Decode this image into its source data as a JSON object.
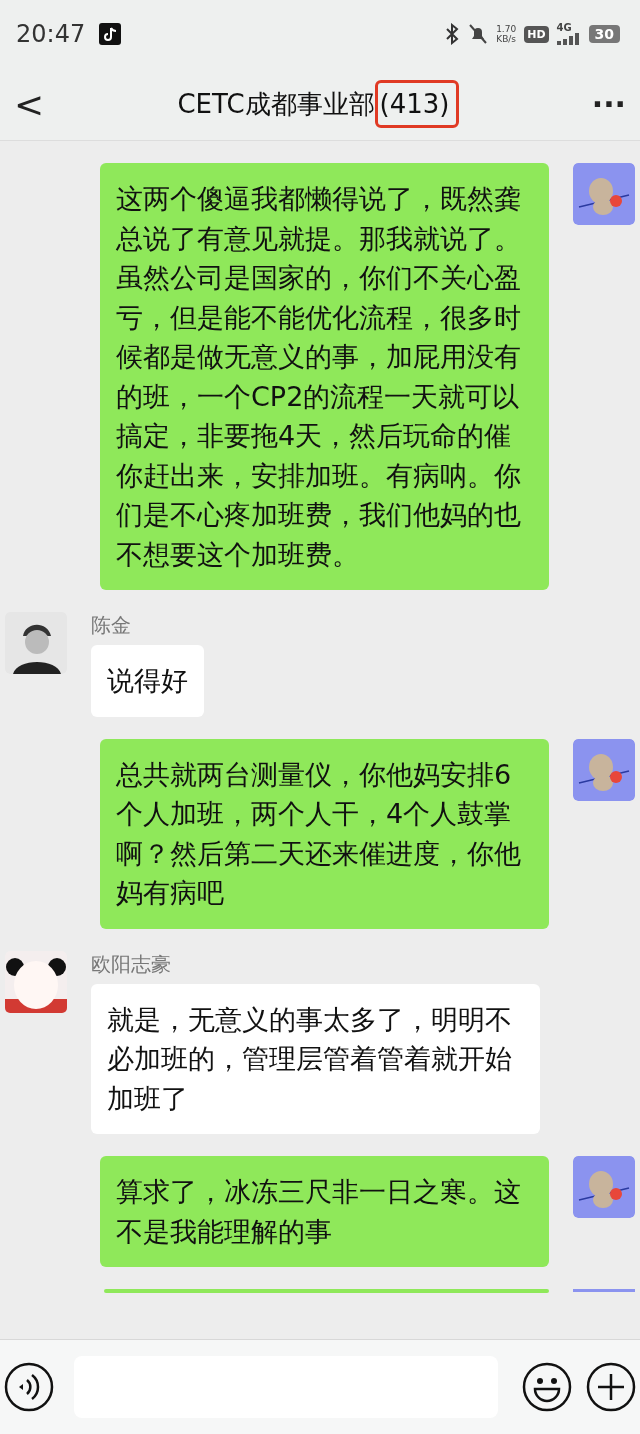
{
  "status_bar": {
    "time": "20:47",
    "net_speed": "1.70",
    "net_unit": "KB/s",
    "hd": "HD",
    "network": "4G",
    "battery": "30"
  },
  "header": {
    "back": "<",
    "title": "CETC成都事业部",
    "count": "(413)",
    "count_highlighted": true,
    "more": "···"
  },
  "messages": [
    {
      "kind": "sent",
      "text": "这两个傻逼我都懒得说了，既然龚总说了有意见就提。那我就说了。虽然公司是国家的，你们不关心盈亏，但是能不能优化流程，很多时候都是做无意义的事，加屁用没有的班，一个CP2的流程一天就可以搞定，非要拖4天，然后玩命的催你赶出来，安排加班。有病呐。你们是不心疼加班费，我们他妈的也不想要这个加班费。"
    },
    {
      "kind": "received",
      "sender": "陈金",
      "text": "说得好"
    },
    {
      "kind": "sent",
      "text": "总共就两台测量仪，你他妈安排6个人加班，两个人干，4个人鼓掌啊？然后第二天还来催进度，你他妈有病吧"
    },
    {
      "kind": "received",
      "sender": "欧阳志豪",
      "text": "就是，无意义的事太多了，明明不必加班的，管理层管着管着就开始加班了"
    },
    {
      "kind": "sent",
      "text": "算求了，冰冻三尺非一日之寒。这不是我能理解的事"
    },
    {
      "kind": "partial"
    }
  ]
}
